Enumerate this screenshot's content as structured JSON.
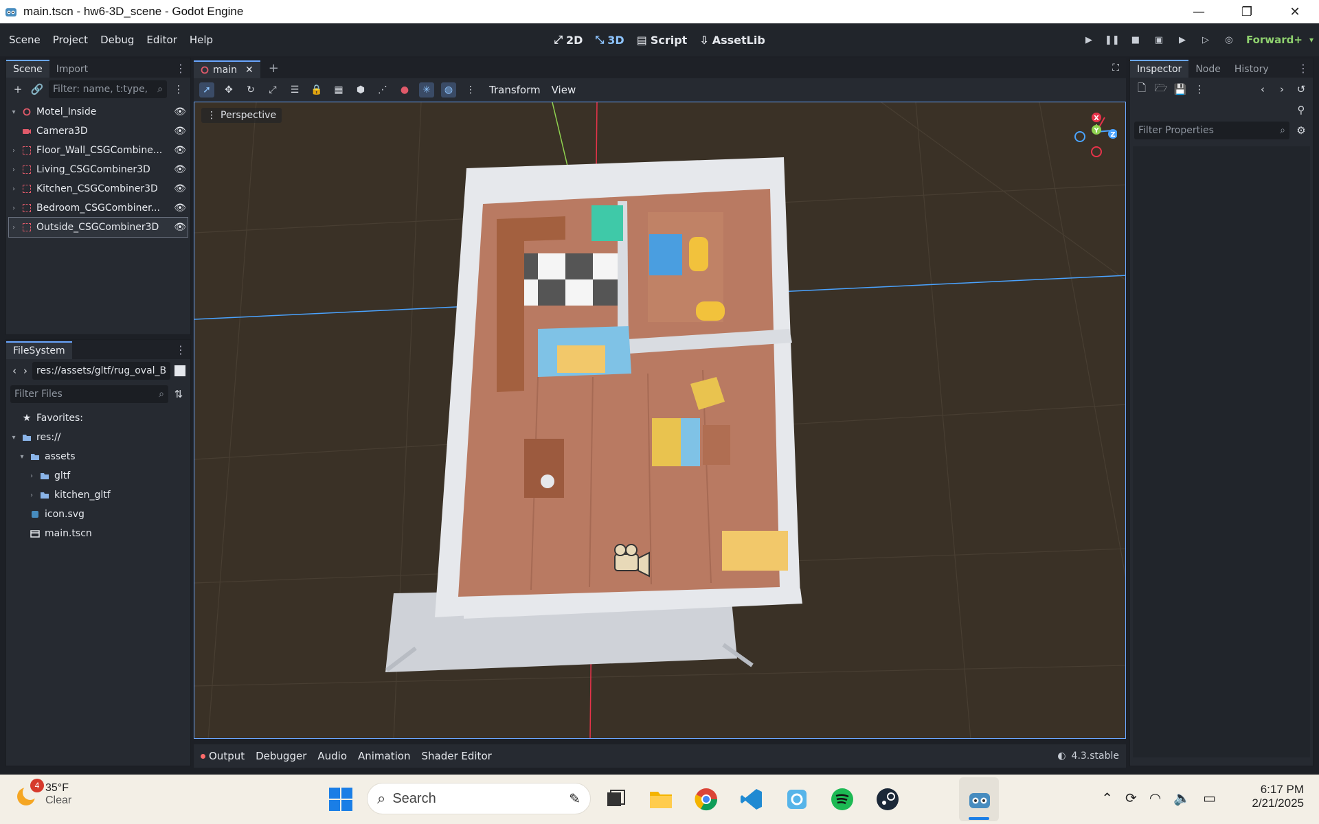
{
  "window": {
    "title": "main.tscn - hw6-3D_scene - Godot Engine",
    "controls": [
      "—",
      "❐",
      "✕"
    ]
  },
  "menubar": {
    "items": [
      "Scene",
      "Project",
      "Debug",
      "Editor",
      "Help"
    ],
    "workspaces": [
      {
        "label": "2D",
        "icon": "2d-icon"
      },
      {
        "label": "3D",
        "icon": "3d-icon"
      },
      {
        "label": "Script",
        "icon": "script-icon"
      },
      {
        "label": "AssetLib",
        "icon": "assetlib-icon"
      }
    ],
    "renderer": "Forward+"
  },
  "scene_dock": {
    "tabs": [
      "Scene",
      "Import"
    ],
    "filter_placeholder": "Filter: name, t:type,",
    "nodes": [
      {
        "label": "Motel_Inside",
        "icon": "node3d-icon",
        "expanded": true
      },
      {
        "label": "Camera3D",
        "icon": "camera-icon"
      },
      {
        "label": "Floor_Wall_CSGCombine...",
        "icon": "csg-icon"
      },
      {
        "label": "Living_CSGCombiner3D",
        "icon": "csg-icon"
      },
      {
        "label": "Kitchen_CSGCombiner3D",
        "icon": "csg-icon"
      },
      {
        "label": "Bedroom_CSGCombiner...",
        "icon": "csg-icon"
      },
      {
        "label": "Outside_CSGCombiner3D",
        "icon": "csg-icon"
      }
    ]
  },
  "filesystem_dock": {
    "tab": "FileSystem",
    "path": "res://assets/gltf/rug_oval_B",
    "filter_placeholder": "Filter Files",
    "items": [
      {
        "label": "Favorites:",
        "icon": "star-icon"
      },
      {
        "label": "res://",
        "icon": "folder-icon"
      },
      {
        "label": "assets",
        "icon": "folder-icon"
      },
      {
        "label": "gltf",
        "icon": "folder-icon"
      },
      {
        "label": "kitchen_gltf",
        "icon": "folder-icon"
      },
      {
        "label": "icon.svg",
        "icon": "svg-file-icon"
      },
      {
        "label": "main.tscn",
        "icon": "scene-file-icon"
      }
    ]
  },
  "editor_tabs": {
    "open": "main",
    "add": "+"
  },
  "viewport_toolbar": {
    "transform_label": "Transform",
    "view_label": "View",
    "perspective_label": "Perspective"
  },
  "gizmo": {
    "x": "X",
    "y": "Y",
    "z": "Z"
  },
  "bottom_panel": {
    "tabs": [
      "Output",
      "Debugger",
      "Audio",
      "Animation",
      "Shader Editor"
    ],
    "version": "4.3.stable"
  },
  "inspector_dock": {
    "tabs": [
      "Inspector",
      "Node",
      "History"
    ],
    "filter_placeholder": "Filter Properties"
  },
  "taskbar": {
    "weather_badge": "4",
    "temperature": "35°F",
    "condition": "Clear",
    "search_placeholder": "Search",
    "time": "6:17 PM",
    "date": "2/21/2025"
  },
  "colors": {
    "accent": "#6aa6ff",
    "viewport_bg": "#3a3126",
    "x_axis": "#e8334a",
    "y_axis": "#8fd14f",
    "z_axis": "#4aa3ff"
  }
}
